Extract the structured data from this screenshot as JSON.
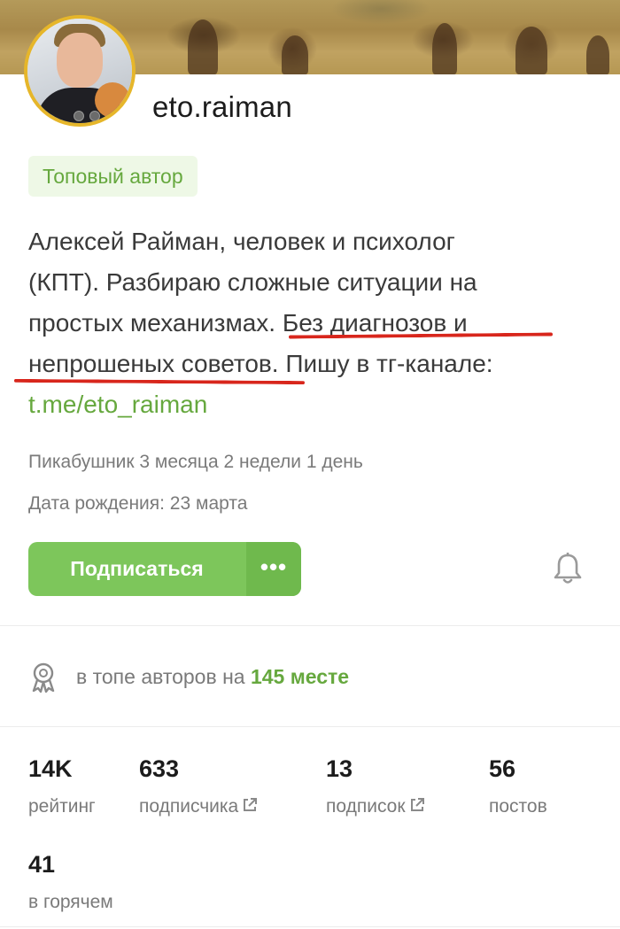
{
  "profile": {
    "username": "eto.raiman",
    "badge": "Топовый автор",
    "bio_line1": "Алексей Райман, человек и психолог",
    "bio_line2": "(КПТ). Разбираю сложные ситуации на",
    "bio_line3a": "простых механизмах.",
    "bio_line3b": " Без диагнозов и",
    "bio_line4a": "непрошеных советов",
    "bio_line4b": ". Пишу в тг-канале:",
    "bio_link": "t.me/eto_raiman",
    "member_since": "Пикабушник 3 месяца 2 недели 1 день",
    "birthday": "Дата рождения: 23 марта"
  },
  "actions": {
    "subscribe_label": "Подписаться",
    "more_label": "•••"
  },
  "rank": {
    "prefix": "в топе авторов на ",
    "place": "145 месте"
  },
  "stats": [
    {
      "value": "14K",
      "label": "рейтинг"
    },
    {
      "value": "633",
      "label": "подписчика"
    },
    {
      "value": "13",
      "label": "подписок"
    },
    {
      "value": "56",
      "label": "постов"
    },
    {
      "value": "41",
      "label": "в горячем"
    }
  ],
  "icons": {
    "bell": "bell-icon",
    "award": "award-icon",
    "external": "external-link-icon"
  },
  "colors": {
    "accent_green": "#66a83e",
    "button_green": "#7dc65b",
    "annotation_red": "#d8261c",
    "avatar_ring": "#e6b62a"
  }
}
